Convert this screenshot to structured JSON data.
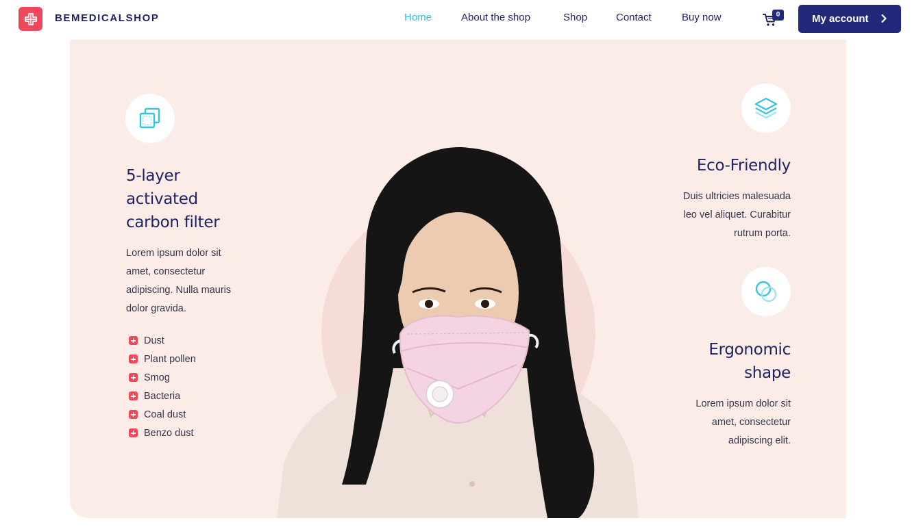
{
  "brand": {
    "name": "BEMEDICALSHOP",
    "logo_icon": "medical-cross-logo-icon",
    "accent": "#f0485b"
  },
  "nav": {
    "items": [
      {
        "label": "Home",
        "active": true
      },
      {
        "label": "About the shop",
        "active": false
      },
      {
        "label": "Shop",
        "active": false
      },
      {
        "label": "Contact",
        "active": false
      },
      {
        "label": "Buy now",
        "active": false
      }
    ],
    "active_color": "#31bee0",
    "text_color": "#1f2360"
  },
  "cart": {
    "icon": "cart-icon",
    "count": "0"
  },
  "account": {
    "label": "My account",
    "icon": "chevron-right-icon",
    "bg_color": "#23297a"
  },
  "hero": {
    "bg_color": "#fcece8",
    "left_feature": {
      "icon": "layers-square-icon",
      "title_lines": [
        "5-layer",
        "activated",
        "carbon filter"
      ],
      "desc_lines": [
        "Lorem ipsum dolor sit",
        "amet, consectetur",
        "adipiscing. Nulla mauris",
        "dolor gravida."
      ],
      "list": [
        "Dust",
        "Plant pollen",
        "Smog",
        "Bacteria",
        "Coal dust",
        "Benzo dust"
      ]
    },
    "right_features": [
      {
        "icon": "stack-layers-icon",
        "title_lines": [
          "Eco-Friendly"
        ],
        "desc_lines": [
          "Duis ultricies malesuada",
          "leo vel aliquet. Curabitur",
          "rutrum porta."
        ]
      },
      {
        "icon": "overlapping-circles-icon",
        "title_lines": [
          "Ergonomic",
          "shape"
        ],
        "desc_lines": [
          "Lorem ipsum dolor sit",
          "amet, consectetur",
          "adipiscing elit."
        ]
      }
    ],
    "image": {
      "icon": "woman-wearing-face-mask-image"
    }
  }
}
